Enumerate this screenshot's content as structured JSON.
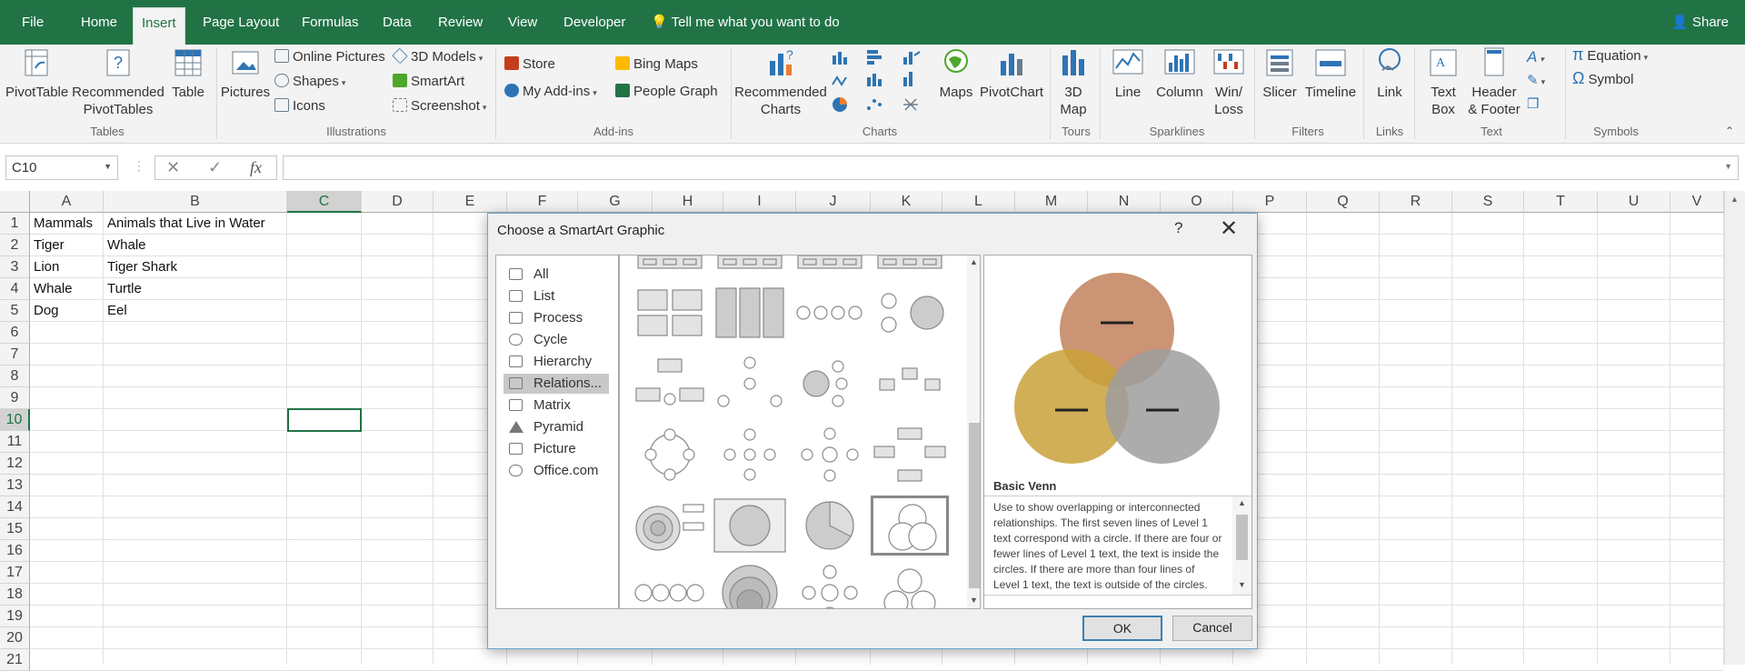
{
  "tabs": [
    "File",
    "Home",
    "Insert",
    "Page Layout",
    "Formulas",
    "Data",
    "Review",
    "View",
    "Developer"
  ],
  "tell_me": "Tell me what you want to do",
  "share": "Share",
  "ribbon": {
    "pivot_table": "PivotTable",
    "rec_pivot_l1": "Recommended",
    "rec_pivot_l2": "PivotTables",
    "table": "Table",
    "pictures": "Pictures",
    "online_pictures": "Online Pictures",
    "shapes": "Shapes",
    "icons": "Icons",
    "models_3d": "3D Models",
    "smartart": "SmartArt",
    "screenshot": "Screenshot",
    "store": "Store",
    "my_addins": "My Add-ins",
    "bing_maps": "Bing Maps",
    "people_graph": "People Graph",
    "rec_charts_l1": "Recommended",
    "rec_charts_l2": "Charts",
    "maps": "Maps",
    "pivot_chart": "PivotChart",
    "map3d_l1": "3D",
    "map3d_l2": "Map",
    "line": "Line",
    "column": "Column",
    "winloss_l1": "Win/",
    "winloss_l2": "Loss",
    "slicer": "Slicer",
    "timeline": "Timeline",
    "link": "Link",
    "textbox_l1": "Text",
    "textbox_l2": "Box",
    "hf_l1": "Header",
    "hf_l2": "& Footer",
    "equation": "Equation",
    "symbol": "Symbol",
    "groups": [
      "Tables",
      "Illustrations",
      "Add-ins",
      "Charts",
      "Tours",
      "Sparklines",
      "Filters",
      "Links",
      "Text",
      "Symbols"
    ]
  },
  "name_box": "C10",
  "fx": "fx",
  "columns": [
    "A",
    "B",
    "C",
    "D",
    "E",
    "F",
    "G",
    "H",
    "I",
    "J",
    "K",
    "L",
    "M",
    "N",
    "O",
    "P",
    "Q",
    "R",
    "S",
    "T",
    "U",
    "V"
  ],
  "rows": [
    "1",
    "2",
    "3",
    "4",
    "5",
    "6",
    "7",
    "8",
    "9",
    "10",
    "11",
    "12",
    "13",
    "14",
    "15",
    "16",
    "17",
    "18",
    "19",
    "20",
    "21"
  ],
  "cells": {
    "a1": "Mammals",
    "b1": "Animals that Live in Water",
    "a2": "Tiger",
    "b2": "Whale",
    "a3": "Lion",
    "b3": "Tiger Shark",
    "a4": "Whale",
    "b4": "Turtle",
    "a5": "Dog",
    "b5": "Eel"
  },
  "dialog": {
    "title": "Choose a SmartArt Graphic",
    "help": "?",
    "close": "✕",
    "categories": [
      "All",
      "List",
      "Process",
      "Cycle",
      "Hierarchy",
      "Relations...",
      "Matrix",
      "Pyramid",
      "Picture",
      "Office.com"
    ],
    "selected_category": "Relations...",
    "preview_name": "Basic Venn",
    "preview_desc": "Use to show overlapping or interconnected relationships. The first seven lines of Level 1 text correspond with a circle. If there are four or fewer lines of Level 1 text, the text is inside the circles. If there are more than four lines of Level 1 text, the text is outside of the circles.",
    "ok": "OK",
    "cancel": "Cancel"
  },
  "colors": {
    "excel_green": "#217346",
    "venn_top": "#c2815c",
    "venn_left": "#c9a13a",
    "venn_right": "#9e9e9e"
  }
}
